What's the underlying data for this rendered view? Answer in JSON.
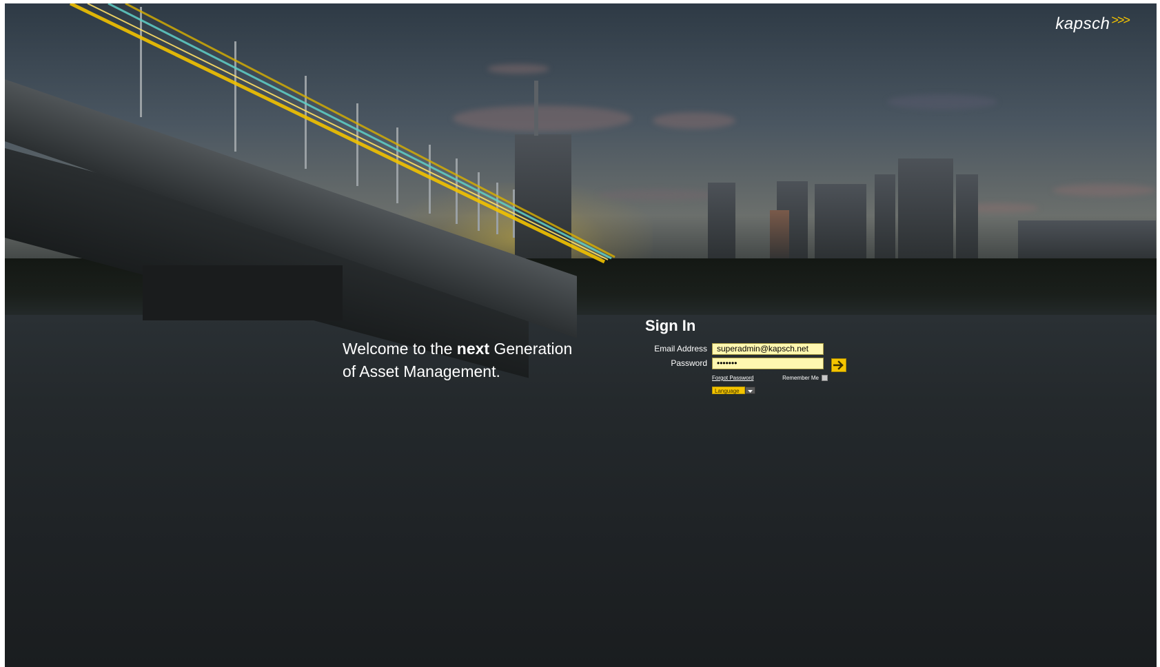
{
  "brand": {
    "logo_text": "kapsch",
    "logo_chevrons": ">>>",
    "accent_color": "#f5c400"
  },
  "welcome": {
    "pre": "Welcome to the ",
    "bold": "next",
    "post": " Generation",
    "line2": "of Asset Management."
  },
  "signin": {
    "title": "Sign In",
    "email_label": "Email Address",
    "email_value": "superadmin@kapsch.net",
    "password_label": "Password",
    "password_value": "•••••••",
    "submit_icon": "arrow-right-icon",
    "forgot_label": "Forgot Password",
    "remember_label": "Remember Me",
    "remember_checked": false,
    "language_label": "Language"
  }
}
